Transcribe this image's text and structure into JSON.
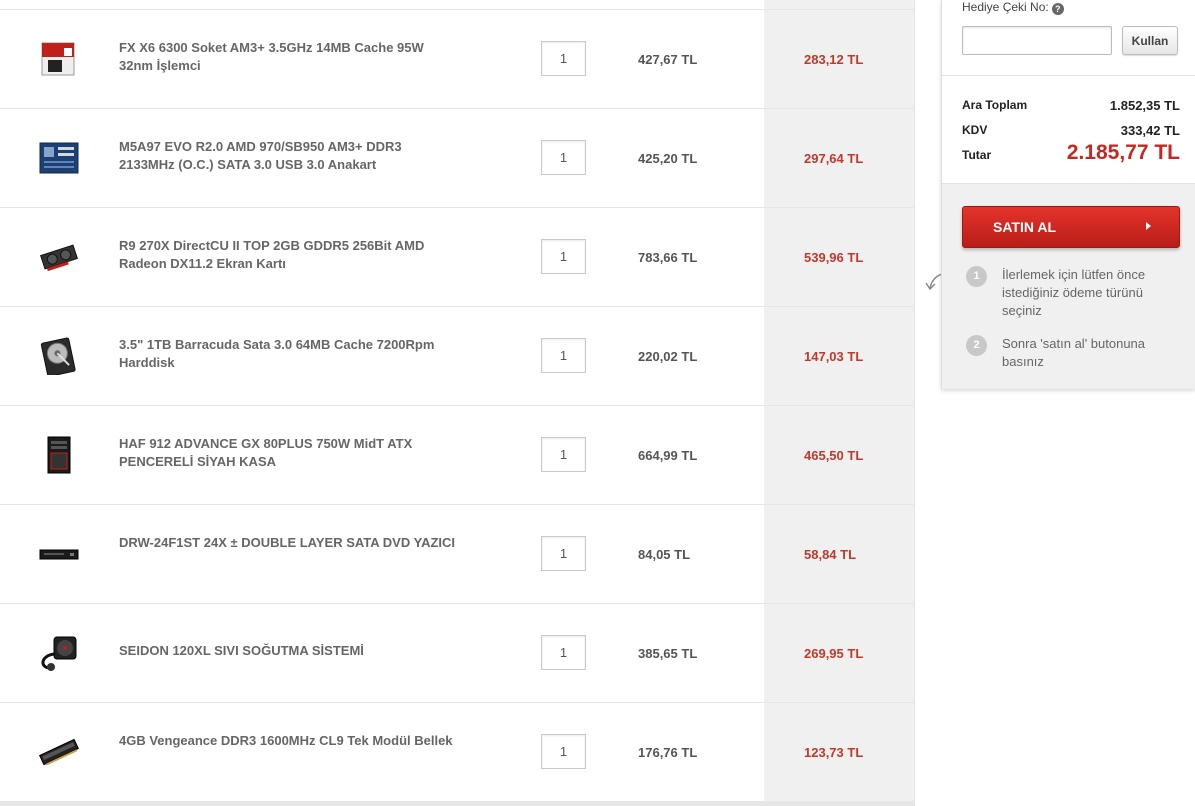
{
  "cart": {
    "items": [
      {
        "name": "FX X6 6300 Soket AM3+ 3.5GHz 14MB Cache 95W 32nm İşlemci",
        "qty": "1",
        "price": "427,67 TL",
        "discount_price": "283,12 TL",
        "icon": "cpu-box-icon"
      },
      {
        "name": "M5A97 EVO R2.0 AMD 970/SB950 AM3+ DDR3 2133MHz (O.C.) SATA 3.0 USB 3.0 Anakart",
        "qty": "1",
        "price": "425,20 TL",
        "discount_price": "297,64 TL",
        "icon": "motherboard-icon"
      },
      {
        "name": "R9 270X DirectCU II TOP 2GB GDDR5 256Bit AMD Radeon DX11.2 Ekran Kartı",
        "qty": "1",
        "price": "783,66 TL",
        "discount_price": "539,96 TL",
        "icon": "graphics-card-icon"
      },
      {
        "name": "3.5\" 1TB Barracuda Sata 3.0 64MB Cache 7200Rpm Harddisk",
        "qty": "1",
        "price": "220,02 TL",
        "discount_price": "147,03 TL",
        "icon": "hard-disk-icon"
      },
      {
        "name": "HAF 912 ADVANCE GX 80PLUS 750W MidT ATX PENCERELİ SİYAH KASA",
        "qty": "1",
        "price": "664,99 TL",
        "discount_price": "465,50 TL",
        "icon": "pc-case-icon"
      },
      {
        "name": "DRW-24F1ST 24X ± DOUBLE LAYER SATA DVD YAZICI",
        "qty": "1",
        "price": "84,05 TL",
        "discount_price": "58,84 TL",
        "icon": "dvd-drive-icon"
      },
      {
        "name": "SEIDON 120XL SIVI SOĞUTMA SİSTEMİ",
        "qty": "1",
        "price": "385,65 TL",
        "discount_price": "269,95 TL",
        "icon": "liquid-cooler-icon"
      },
      {
        "name": "4GB Vengeance DDR3 1600MHz CL9 Tek Modül Bellek",
        "qty": "1",
        "price": "176,76 TL",
        "discount_price": "123,73 TL",
        "icon": "ram-module-icon"
      }
    ]
  },
  "summary": {
    "gift_label": "Hediye Çeki No:",
    "use_button": "Kullan",
    "subtotal_label": "Ara Toplam",
    "subtotal_value": "1.852,35 TL",
    "vat_label": "KDV",
    "vat_value": "333,42 TL",
    "total_label": "Tutar",
    "total_value": "2.185,77 TL",
    "buy_button": "SATIN AL",
    "steps": [
      {
        "num": "1",
        "text": "İlerlemek için lütfen önce istediğiniz ödeme türünü seçiniz"
      },
      {
        "num": "2",
        "text": "Sonra 'satın al' butonuna basınız"
      }
    ]
  },
  "colors": {
    "accent_red": "#c8261f",
    "discount_red": "#c0392b",
    "header_blue": "#3b8fd1"
  }
}
